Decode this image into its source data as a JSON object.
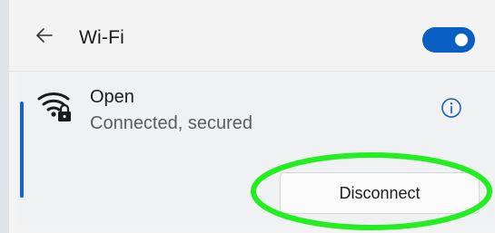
{
  "header": {
    "back_icon": "arrow-left-icon",
    "title": "Wi-Fi",
    "toggle_on": true,
    "toggle_color": "#0a5fc4"
  },
  "network": {
    "icon": "wifi-secured-icon",
    "name": "Open",
    "status": "Connected, secured",
    "info_icon": "info-icon",
    "disconnect_label": "Disconnect"
  },
  "annotation": {
    "shape": "oval",
    "color": "#22ee22",
    "target": "disconnect-button"
  }
}
